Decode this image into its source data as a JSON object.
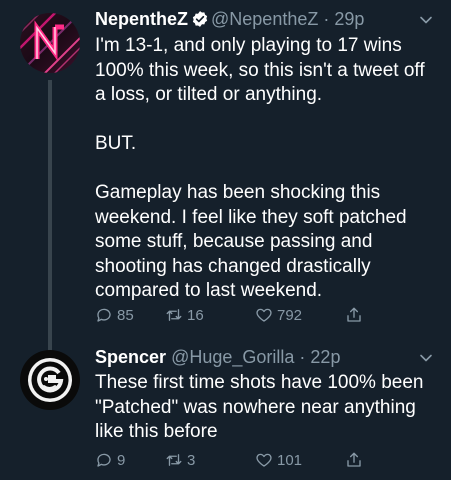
{
  "tweets": [
    {
      "name": "NepentheZ",
      "handle": "@NepentheZ",
      "separator": "·",
      "time": "29p",
      "text": "I'm 13-1, and only playing to 17 wins 100% this week, so this isn't a tweet off a loss, or tilted or anything.\n\nBUT.\n\nGameplay has been shocking this weekend. I feel like they soft patched some stuff, because passing and shooting has changed drastically compared to last weekend.",
      "replies": "85",
      "retweets": "16",
      "likes": "792",
      "verified": true
    },
    {
      "name": "Spencer",
      "handle": "@Huge_Gorilla",
      "separator": "·",
      "time": "22p",
      "text": "These first time shots have 100% been \"Patched\" was nowhere near anything like this before",
      "replies": "9",
      "retweets": "3",
      "likes": "101",
      "verified": false
    }
  ],
  "colors": {
    "background": "#15202b",
    "secondary_text": "#8899a6",
    "thread_line": "#38444d",
    "verified": "#ffffff"
  }
}
